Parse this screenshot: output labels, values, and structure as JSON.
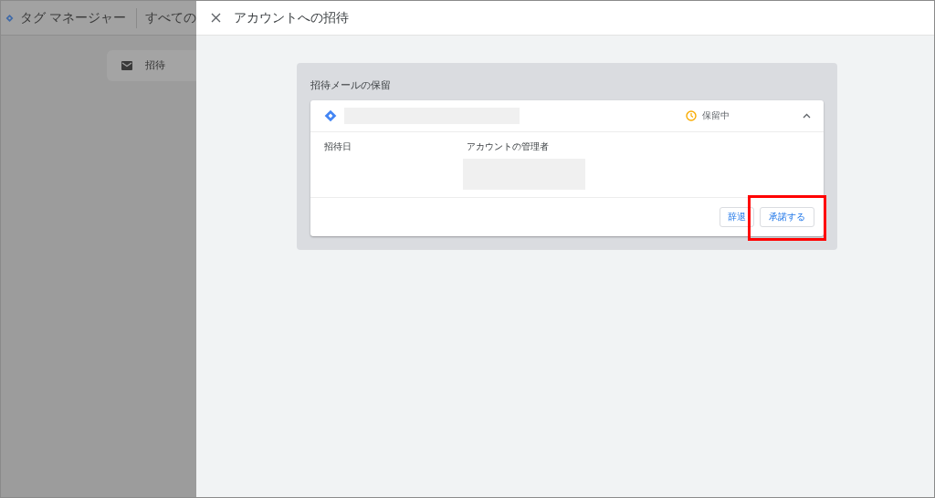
{
  "background_app": {
    "product_name": "タグ マネージャー",
    "header_text": "すべての",
    "nav_item": "招待"
  },
  "dialog": {
    "title": "アカウントへの招待",
    "section_title": "招待メールの保留",
    "invitation": {
      "status": "保留中",
      "expanded": true,
      "columns": [
        "招待日",
        "アカウントの管理者"
      ],
      "buttons": [
        {
          "label": "辞退",
          "highlighted": false
        },
        {
          "label": "承諾する",
          "highlighted": true
        }
      ]
    }
  }
}
